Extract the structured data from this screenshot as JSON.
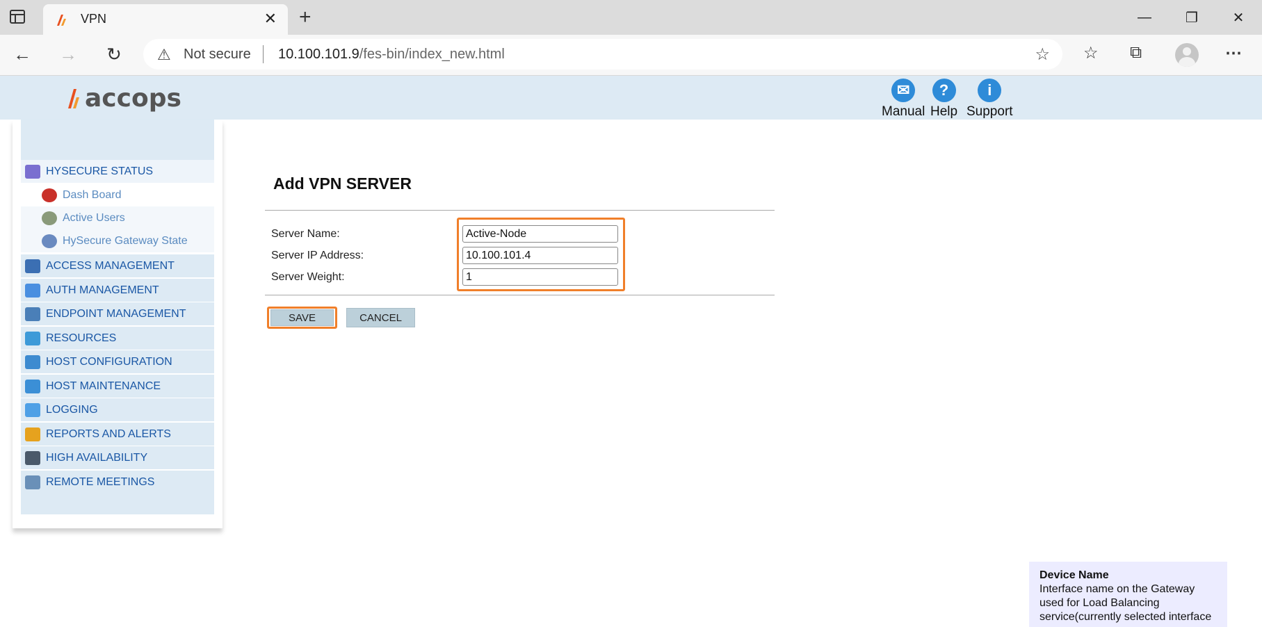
{
  "browser": {
    "tab_title": "VPN",
    "not_secure": "Not secure",
    "url_host": "10.100.101.9",
    "url_path": "/fes-bin/index_new.html"
  },
  "header": {
    "logo_text": "accops",
    "links": [
      {
        "label": "Manual",
        "icon": "manual-icon",
        "color": "#2e8bd8"
      },
      {
        "label": "Help",
        "icon": "help-icon",
        "color": "#2e8bd8"
      },
      {
        "label": "Support",
        "icon": "info-icon",
        "color": "#2e8bd8"
      }
    ]
  },
  "sidebar": {
    "sections": [
      {
        "label": "HYSECURE STATUS",
        "icon": "status-icon",
        "color": "#7a6fd0"
      },
      {
        "label": "ACCESS MANAGEMENT",
        "icon": "access-icon",
        "color": "#3b6fb3"
      },
      {
        "label": "AUTH MANAGEMENT",
        "icon": "lock-icon",
        "color": "#4a8fe0"
      },
      {
        "label": "ENDPOINT MANAGEMENT",
        "icon": "scale-icon",
        "color": "#4a7fb8"
      },
      {
        "label": "RESOURCES",
        "icon": "resources-icon",
        "color": "#3d9ad8"
      },
      {
        "label": "HOST CONFIGURATION",
        "icon": "gear-icon",
        "color": "#3d8bd0"
      },
      {
        "label": "HOST MAINTENANCE",
        "icon": "cart-icon",
        "color": "#3b8fd6"
      },
      {
        "label": "LOGGING",
        "icon": "calendar-icon",
        "color": "#4ea0e6"
      },
      {
        "label": "REPORTS AND ALERTS",
        "icon": "bar-chart-icon",
        "color": "#e6a21e"
      },
      {
        "label": "HIGH AVAILABILITY",
        "icon": "grid-icon",
        "color": "#4b5a6a"
      },
      {
        "label": "REMOTE MEETINGS",
        "icon": "meeting-icon",
        "color": "#6a90b8"
      }
    ],
    "sub_items": [
      {
        "label": "Dash Board",
        "icon": "dashboard-icon",
        "color": "#c9312a"
      },
      {
        "label": "Active Users",
        "icon": "users-icon",
        "color": "#8a9a7a"
      },
      {
        "label": "HySecure Gateway State",
        "icon": "gateway-icon",
        "color": "#6a8ac0"
      }
    ]
  },
  "form": {
    "title": "Add VPN SERVER",
    "fields": [
      {
        "label": "Server Name:",
        "value": "Active-Node"
      },
      {
        "label": "Server IP Address:",
        "value": "10.100.101.4"
      },
      {
        "label": "Server Weight:",
        "value": "1"
      }
    ],
    "save_label": "SAVE",
    "cancel_label": "CANCEL"
  },
  "tooltip": {
    "title": "Device Name",
    "line1": "Interface name on the Gateway",
    "line2": "used for Load Balancing",
    "line3": "service(currently selected interface"
  },
  "colors": {
    "highlight": "#f07f2a",
    "header_bg": "#ddeaf4",
    "menu_text": "#1a57a5"
  }
}
